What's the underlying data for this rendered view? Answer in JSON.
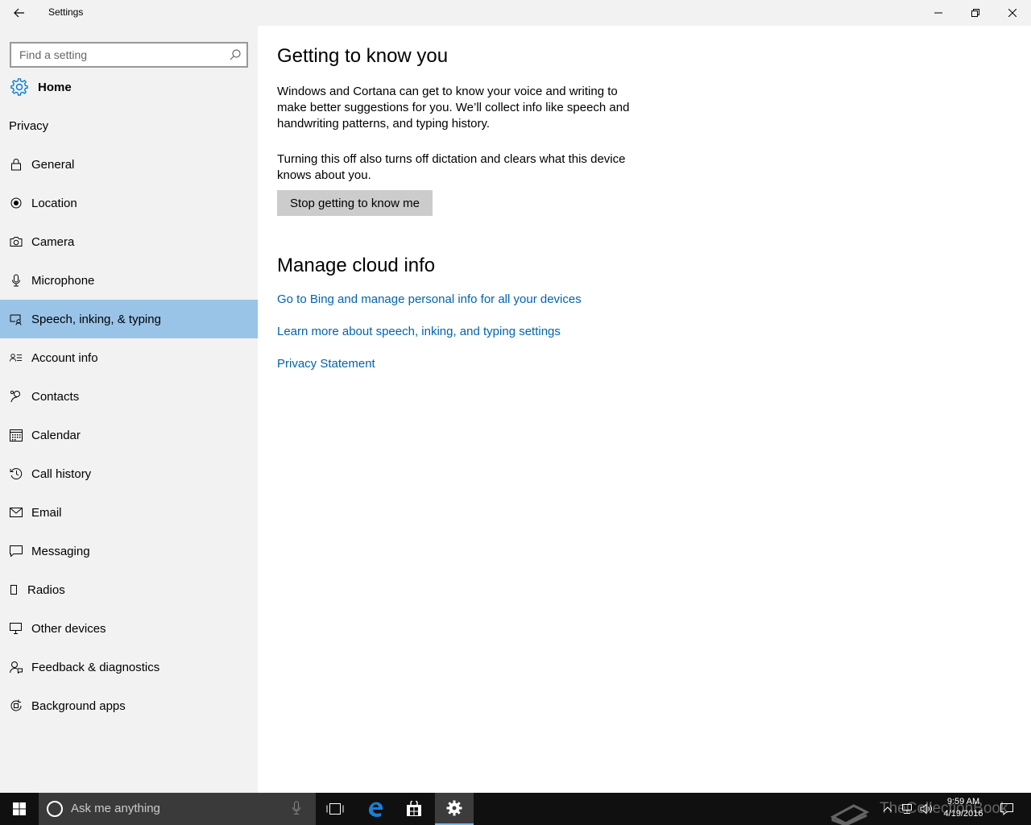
{
  "window": {
    "title": "Settings"
  },
  "sidebar": {
    "search_placeholder": "Find a setting",
    "home_label": "Home",
    "section_label": "Privacy",
    "items": [
      {
        "label": "General",
        "icon": "lock-icon"
      },
      {
        "label": "Location",
        "icon": "location-icon"
      },
      {
        "label": "Camera",
        "icon": "camera-icon"
      },
      {
        "label": "Microphone",
        "icon": "microphone-icon"
      },
      {
        "label": "Speech, inking, & typing",
        "icon": "speech-inking-icon",
        "selected": true
      },
      {
        "label": "Account info",
        "icon": "account-info-icon"
      },
      {
        "label": "Contacts",
        "icon": "contacts-icon"
      },
      {
        "label": "Calendar",
        "icon": "calendar-icon"
      },
      {
        "label": "Call history",
        "icon": "call-history-icon"
      },
      {
        "label": "Email",
        "icon": "email-icon"
      },
      {
        "label": "Messaging",
        "icon": "messaging-icon"
      },
      {
        "label": "Radios",
        "icon": "radios-icon"
      },
      {
        "label": "Other devices",
        "icon": "other-devices-icon"
      },
      {
        "label": "Feedback & diagnostics",
        "icon": "feedback-icon"
      },
      {
        "label": "Background apps",
        "icon": "background-apps-icon"
      }
    ]
  },
  "main": {
    "heading1": "Getting to know you",
    "paragraph1": "Windows and Cortana can get to know your voice and writing to make better suggestions for you. We’ll collect info like speech and handwriting patterns, and typing history.",
    "paragraph2": "Turning this off also turns off dictation and clears what this device knows about you.",
    "button_label": "Stop getting to know me",
    "heading2": "Manage cloud info",
    "links": [
      "Go to Bing and manage personal info for all your devices",
      "Learn more about speech, inking, and typing settings",
      "Privacy Statement"
    ]
  },
  "taskbar": {
    "search_placeholder": "Ask me anything",
    "time": "9:59 AM",
    "date": "4/19/2016",
    "watermark": "TheCollectionBook"
  },
  "colors": {
    "accent": "#0078d7",
    "selected_nav": "#99c4e8",
    "link": "#0063b1",
    "sidebar_bg": "#f2f2f2",
    "taskbar_bg": "#101010"
  }
}
